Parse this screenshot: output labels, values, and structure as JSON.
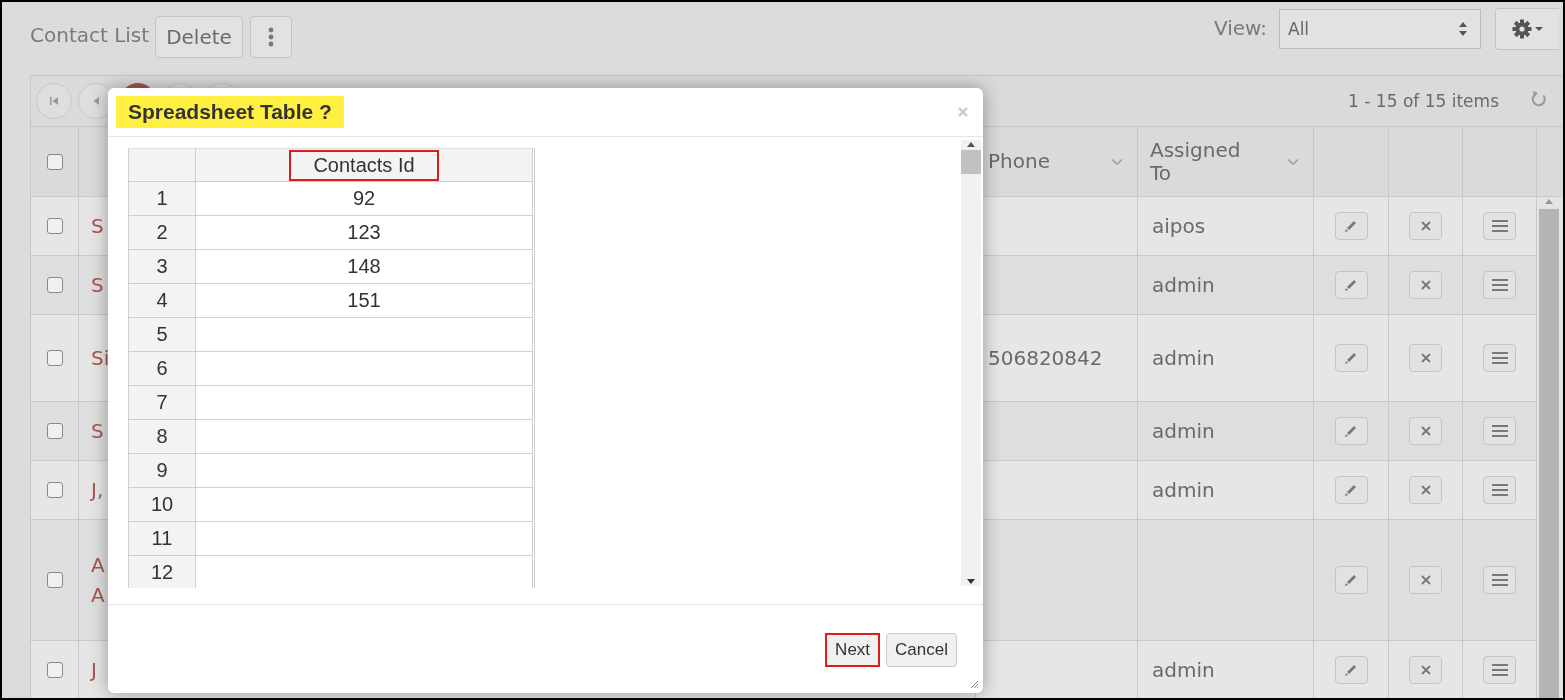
{
  "toolbar": {
    "title": "Contact List",
    "delete_button": "Delete",
    "view_label": "View:",
    "view_value": "All"
  },
  "grid": {
    "pager": [
      {
        "kind": "first",
        "selected": false
      },
      {
        "kind": "prev",
        "selected": false
      },
      {
        "kind": "page",
        "selected": true
      },
      {
        "kind": "next",
        "selected": false
      },
      {
        "kind": "last",
        "selected": false
      }
    ],
    "summary": "1 - 15 of 15 items",
    "header_checked": false,
    "columns": [
      {
        "label": "Phone"
      },
      {
        "label": "Assigned To"
      }
    ],
    "rows": [
      {
        "checked": false,
        "name": [
          "S"
        ],
        "assigned": "aipos"
      },
      {
        "checked": false,
        "name": [
          "S"
        ],
        "assigned": "admin"
      },
      {
        "checked": false,
        "name": [
          "Si"
        ],
        "phone": "506820842",
        "assigned": "admin"
      },
      {
        "checked": false,
        "name": [
          "S"
        ],
        "assigned": "admin"
      },
      {
        "checked": false,
        "name": [
          "J,"
        ],
        "assigned": "admin"
      },
      {
        "checked": false,
        "name": [
          "A",
          "A"
        ]
      },
      {
        "checked": false,
        "name": [
          "J"
        ],
        "assigned": "admin"
      }
    ]
  },
  "dialog": {
    "title": "Spreadsheet Table ?",
    "title_highlighted": true,
    "sheet": {
      "column": "Contacts Id",
      "column_highlighted": true,
      "rows": [
        {
          "n": "1",
          "value": "92"
        },
        {
          "n": "2",
          "value": "123"
        },
        {
          "n": "3",
          "value": "148"
        },
        {
          "n": "4",
          "value": "151"
        },
        {
          "n": "5"
        },
        {
          "n": "6"
        },
        {
          "n": "7"
        },
        {
          "n": "8"
        },
        {
          "n": "9"
        },
        {
          "n": "10"
        },
        {
          "n": "11"
        },
        {
          "n": "12"
        }
      ]
    },
    "buttons": [
      {
        "label": "Next",
        "highlighted": true
      },
      {
        "label": "Cancel",
        "highlighted": false
      }
    ]
  }
}
